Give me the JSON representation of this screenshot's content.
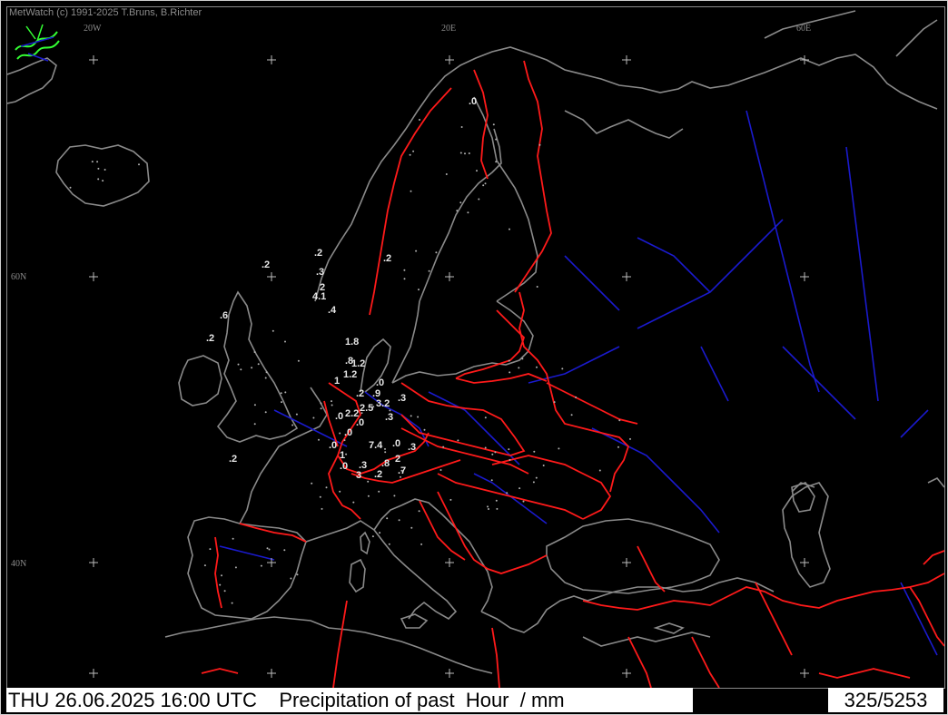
{
  "app": {
    "copyright": "MetWatch  (c) 1991-2025 T.Bruns, B.Richter"
  },
  "footer": {
    "title": "THU 26.06.2025 16:00 UTC    Precipitation of past  Hour  / mm",
    "count": "325/5253"
  },
  "map": {
    "grid_labels": [
      "20W",
      "20E",
      "60E",
      "60N",
      "40N"
    ],
    "colors": {
      "background": "#000000",
      "coastline": "#8a8a8a",
      "border": "#ff1a1a",
      "river": "#1a1acc",
      "value_low": "#33ff33",
      "value_mid": "#ffff66",
      "station": "#e6e6e6"
    },
    "stations": [
      {
        "text": ".0",
        "c": "low"
      },
      {
        "text": ".2",
        "c": "low"
      },
      {
        "text": ".2",
        "c": "low"
      },
      {
        "text": ".3",
        "c": "low"
      },
      {
        "text": "2",
        "c": "mid"
      },
      {
        "text": "4.1",
        "c": "mid"
      },
      {
        "text": ".4",
        "c": "low"
      },
      {
        "text": ".2",
        "c": "low"
      },
      {
        "text": ".6",
        "c": "low"
      },
      {
        "text": ".2",
        "c": "low"
      },
      {
        "text": "1.8",
        "c": "mid"
      },
      {
        "text": ".8",
        "c": "low"
      },
      {
        "text": "1.2",
        "c": "mid"
      },
      {
        "text": "1.2",
        "c": "mid"
      },
      {
        "text": "1",
        "c": "low"
      },
      {
        "text": ".0",
        "c": "low"
      },
      {
        "text": ".2",
        "c": "low"
      },
      {
        "text": ".9",
        "c": "low"
      },
      {
        "text": ".3",
        "c": "low"
      },
      {
        "text": "2.2",
        "c": "mid"
      },
      {
        "text": "2.5",
        "c": "mid"
      },
      {
        "text": "3.2",
        "c": "mid"
      },
      {
        "text": ".0",
        "c": "low"
      },
      {
        "text": ".0",
        "c": "low"
      },
      {
        "text": ".3",
        "c": "low"
      },
      {
        "text": ".0",
        "c": "low"
      },
      {
        "text": ".0",
        "c": "low"
      },
      {
        "text": "7.4",
        "c": "mid"
      },
      {
        "text": ".0",
        "c": "low"
      },
      {
        "text": ".3",
        "c": "low"
      },
      {
        "text": "1",
        "c": "low"
      },
      {
        "text": "2",
        "c": "mid"
      },
      {
        "text": ".0",
        "c": "low"
      },
      {
        "text": ".3",
        "c": "low"
      },
      {
        "text": ".8",
        "c": "low"
      },
      {
        "text": ".7",
        "c": "low"
      },
      {
        "text": "3",
        "c": "mid"
      },
      {
        "text": ".2",
        "c": "low"
      },
      {
        "text": ".2",
        "c": "low"
      }
    ]
  }
}
